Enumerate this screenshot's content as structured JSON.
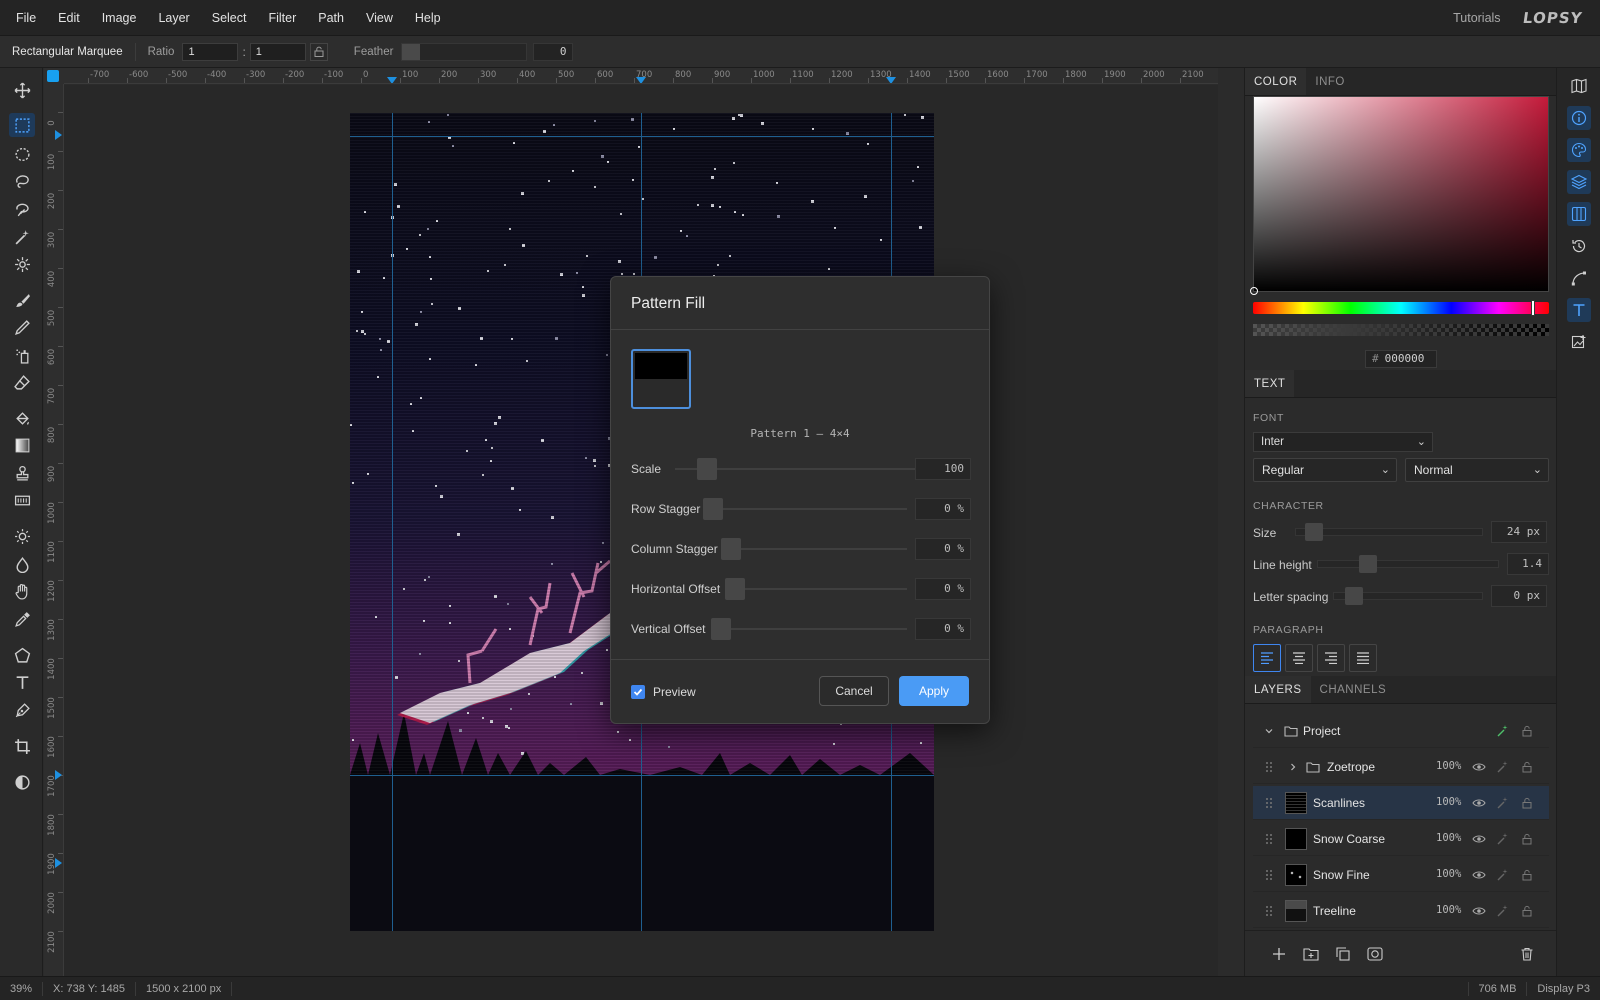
{
  "menu": {
    "items": [
      "File",
      "Edit",
      "Image",
      "Layer",
      "Select",
      "Filter",
      "Path",
      "View",
      "Help"
    ],
    "tutorials": "Tutorials",
    "logo": "LOPSY"
  },
  "options": {
    "tool_name": "Rectangular Marquee",
    "ratio_label": "Ratio",
    "ratio_w": "1",
    "ratio_h": "1",
    "colon": ":",
    "feather_label": "Feather",
    "feather_value": "0"
  },
  "rulers": {
    "top": [
      "-700",
      "-600",
      "-500",
      "-400",
      "-300",
      "-200",
      "-100",
      "0",
      "100",
      "200",
      "300",
      "400",
      "500",
      "600",
      "700",
      "800",
      "900",
      "1000",
      "1100",
      "1200",
      "1300",
      "1400",
      "1500",
      "1600",
      "1700",
      "1800",
      "1900",
      "2000",
      "2100",
      "2200"
    ],
    "left": [
      "0",
      "100",
      "200",
      "300",
      "400",
      "500",
      "600",
      "700",
      "800",
      "900",
      "1000",
      "1100",
      "1200",
      "1300",
      "1400",
      "1500",
      "1600",
      "1700",
      "1800",
      "1900",
      "2000",
      "2100"
    ]
  },
  "dialog": {
    "title": "Pattern Fill",
    "pattern_name": "Pattern 1 — 4×4",
    "rows": [
      {
        "label": "Scale",
        "value": "100",
        "unit": ""
      },
      {
        "label": "Row Stagger",
        "value": "0",
        "unit": "%"
      },
      {
        "label": "Column Stagger",
        "value": "0",
        "unit": "%"
      },
      {
        "label": "Horizontal Offset",
        "value": "0",
        "unit": "%"
      },
      {
        "label": "Vertical Offset",
        "value": "0",
        "unit": "%"
      }
    ],
    "preview_label": "Preview",
    "preview_checked": true,
    "cancel_label": "Cancel",
    "apply_label": "Apply"
  },
  "color_panel": {
    "tabs": [
      "COLOR",
      "INFO"
    ],
    "hex_prefix": "#",
    "hex": "000000"
  },
  "text_panel": {
    "tab": "TEXT",
    "font_label": "FONT",
    "font": "Inter",
    "weight": "Regular",
    "style": "Normal",
    "character_label": "CHARACTER",
    "size_label": "Size",
    "size_value": "24 px",
    "line_height_label": "Line height",
    "line_height_value": "1.4",
    "letter_spacing_label": "Letter spacing",
    "letter_spacing_value": "0 px",
    "paragraph_label": "PARAGRAPH"
  },
  "layers_panel": {
    "tabs": [
      "LAYERS",
      "CHANNELS"
    ],
    "project": "Project",
    "layers": [
      {
        "name": "Zoetrope",
        "opacity": "100%"
      },
      {
        "name": "Scanlines",
        "opacity": "100%"
      },
      {
        "name": "Snow Coarse",
        "opacity": "100%"
      },
      {
        "name": "Snow Fine",
        "opacity": "100%"
      },
      {
        "name": "Treeline",
        "opacity": "100%"
      }
    ]
  },
  "status": {
    "zoom": "39%",
    "coords": "X: 738 Y: 1485",
    "dims": "1500 x 2100 px",
    "memory": "706 MB",
    "color_profile": "Display P3"
  },
  "colors": {
    "accent": "#4a9bf5",
    "guide": "#1f5f8f",
    "panel_bg": "#2b2b2b",
    "selected_layer": "#273446"
  }
}
